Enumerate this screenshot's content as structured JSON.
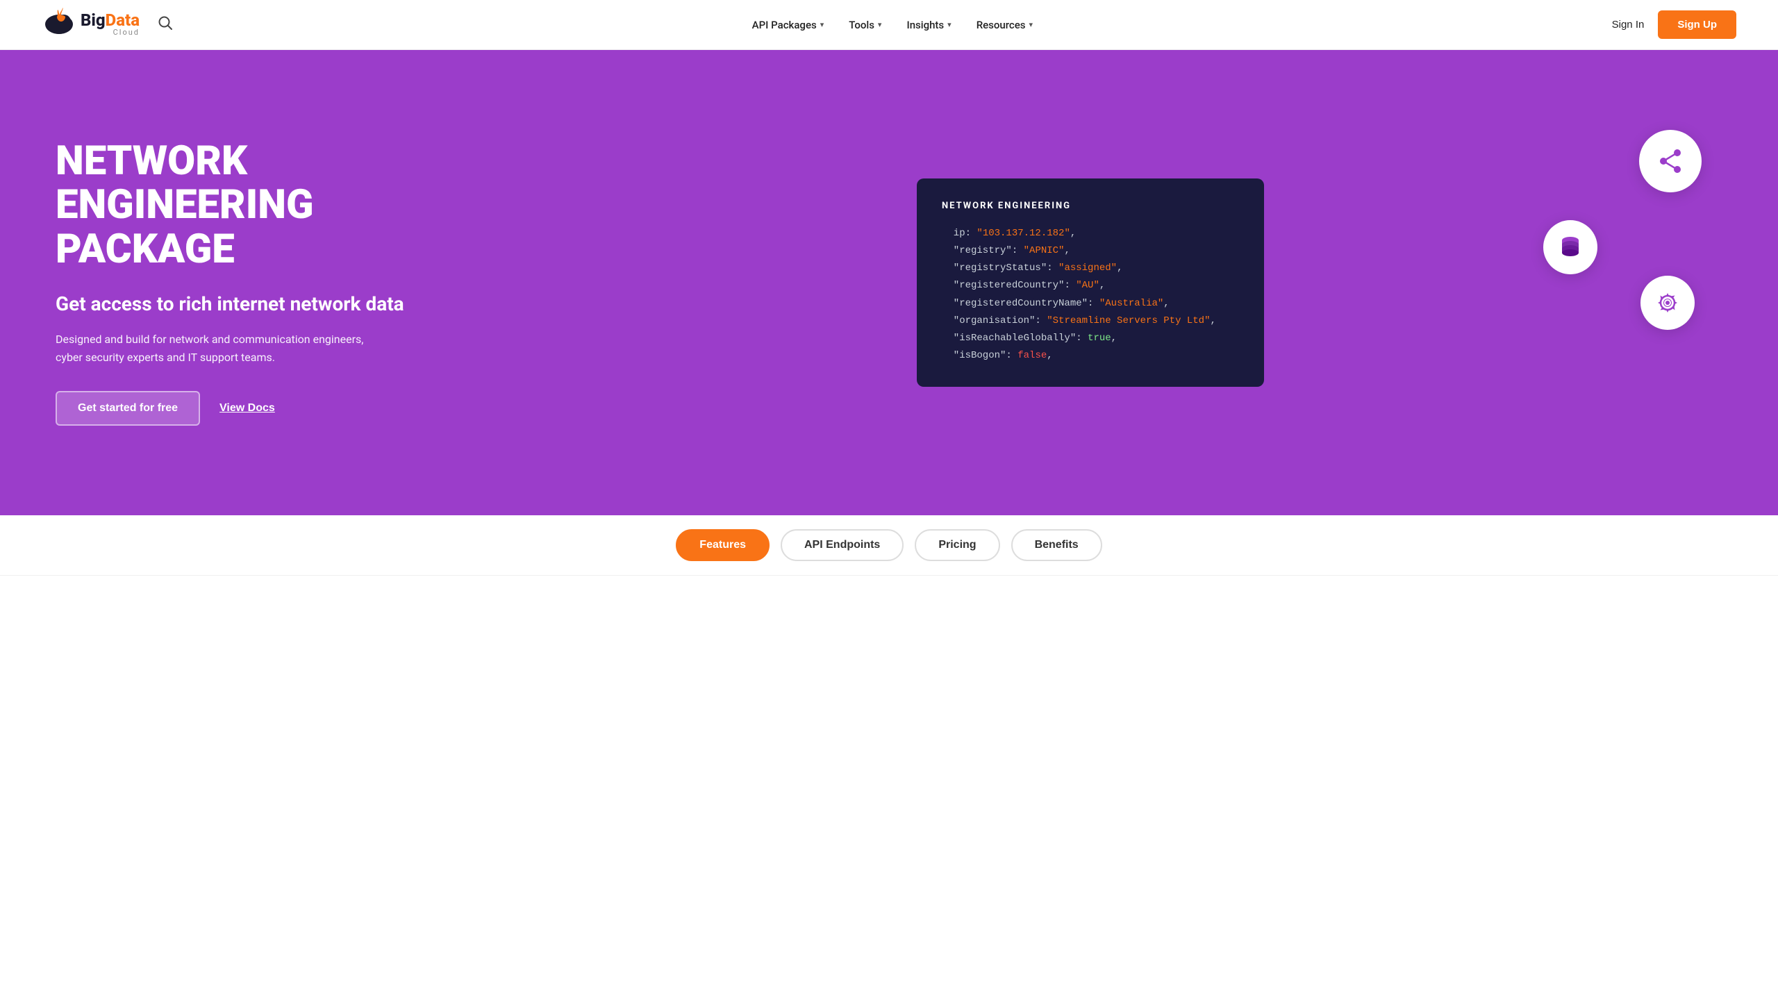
{
  "brand": {
    "name_big": "Big",
    "name_data": "Data",
    "name_cloud": "Cloud",
    "logo_icon": "☁"
  },
  "nav": {
    "search_label": "search",
    "items": [
      {
        "label": "API Packages",
        "has_dropdown": true
      },
      {
        "label": "Tools",
        "has_dropdown": true
      },
      {
        "label": "Insights",
        "has_dropdown": true
      },
      {
        "label": "Resources",
        "has_dropdown": true
      }
    ],
    "signin_label": "Sign In",
    "signup_label": "Sign Up"
  },
  "hero": {
    "title": "NETWORK ENGINEERING PACKAGE",
    "subtitle": "Get access to rich internet network data",
    "description": "Designed and build for network and communication engineers, cyber security experts and IT support teams.",
    "cta_start": "Get started for free",
    "cta_docs": "View Docs",
    "code_card_title": "NETWORK ENGINEERING",
    "code_lines": [
      {
        "key": "ip",
        "value": "\"103.137.12.182\"",
        "type": "string"
      },
      {
        "key": "\"registry\"",
        "value": "\"APNIC\"",
        "type": "string"
      },
      {
        "key": "\"registryStatus\"",
        "value": "\"assigned\"",
        "type": "string"
      },
      {
        "key": "\"registeredCountry\"",
        "value": "\"AU\"",
        "type": "string"
      },
      {
        "key": "\"registeredCountryName\"",
        "value": "\"Australia\"",
        "type": "string"
      },
      {
        "key": "\"organisation\"",
        "value": "\"Streamline Servers Pty Ltd\"",
        "type": "string"
      },
      {
        "key": "\"isReachableGlobally\"",
        "value": "true",
        "type": "bool_true"
      },
      {
        "key": "\"isBogon\"",
        "value": "false",
        "type": "bool_false"
      }
    ],
    "float_icons": [
      "share",
      "database",
      "gear"
    ]
  },
  "tabs": [
    {
      "label": "Features",
      "active": true
    },
    {
      "label": "API Endpoints",
      "active": false
    },
    {
      "label": "Pricing",
      "active": false
    },
    {
      "label": "Benefits",
      "active": false
    }
  ],
  "colors": {
    "hero_bg": "#9b3dca",
    "signup_bg": "#f97316",
    "tab_active_bg": "#f97316"
  }
}
